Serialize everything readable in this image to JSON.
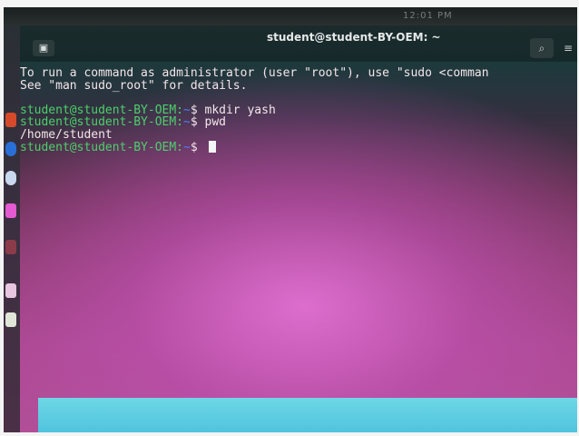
{
  "screen": {
    "clock_text": "12:01 PM"
  },
  "terminal": {
    "title": "student@student-BY-OEM: ~",
    "search_icon": "search-icon",
    "menu_icon": "menu-icon",
    "lines": [
      {
        "kind": "text",
        "text": "To run a command as administrator (user \"root\"), use \"sudo <comman"
      },
      {
        "kind": "text",
        "text": "See \"man sudo_root\" for details."
      },
      {
        "kind": "blank",
        "text": ""
      },
      {
        "kind": "prompt",
        "user": "student@student-BY-OEM:",
        "path": "~",
        "symbol": "$",
        "cmd": " mkdir yash"
      },
      {
        "kind": "prompt",
        "user": "student@student-BY-OEM:",
        "path": "~",
        "symbol": "$",
        "cmd": " pwd"
      },
      {
        "kind": "text",
        "text": "/home/student"
      },
      {
        "kind": "prompt",
        "user": "student@student-BY-OEM:",
        "path": "~",
        "symbol": "$",
        "cmd": " "
      }
    ]
  },
  "colors": {
    "prompt_user": "#4bd06a",
    "prompt_path": "#4b7cff",
    "text": "#f3e6ea",
    "taskbar": "#6ed7e5"
  }
}
